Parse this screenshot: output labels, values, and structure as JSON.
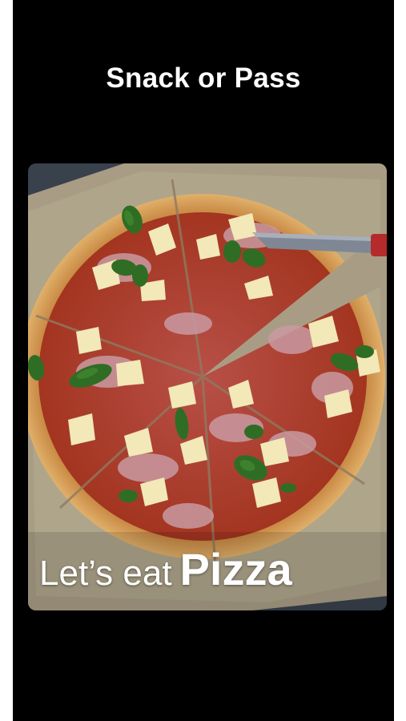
{
  "app": {
    "title": "Snack or Pass"
  },
  "card": {
    "caption_lead": "Let’s eat",
    "food_name": "Pizza",
    "image_subject": "pizza-photo"
  },
  "colors": {
    "background": "#000000",
    "text": "#ffffff"
  }
}
